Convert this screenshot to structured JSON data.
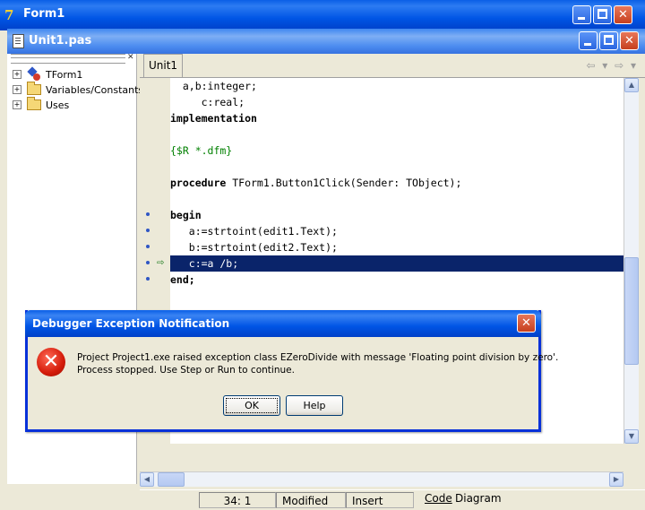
{
  "form_window": {
    "title": "Form1",
    "icon_label": "7"
  },
  "unit_window": {
    "title": "Unit1.pas"
  },
  "tree": {
    "items": [
      {
        "label": "TForm1",
        "icon": "form-class-icon"
      },
      {
        "label": "Variables/Constants",
        "icon": "folder-icon"
      },
      {
        "label": "Uses",
        "icon": "folder-icon"
      }
    ]
  },
  "editor": {
    "tab": "Unit1",
    "lines": [
      "  a,b:integer;",
      "     c:real;",
      "implementation",
      "",
      "{$R *.dfm}",
      "",
      "procedure TForm1.Button1Click(Sender: TObject);",
      "",
      "begin",
      "   a:=strtoint(edit1.Text);",
      "   b:=strtoint(edit2.Text);",
      "   c:=a /b;",
      "end;"
    ]
  },
  "status": {
    "position": "34:  1",
    "modified": "Modified",
    "insert": "Insert",
    "tab_code": "Code",
    "tab_diagram": "Diagram"
  },
  "dialog": {
    "title": "Debugger Exception Notification",
    "message_line1": "Project Project1.exe raised exception class EZeroDivide with message 'Floating point division by zero'.",
    "message_line2": "Process stopped. Use Step or Run to continue.",
    "ok_label": "OK",
    "help_label": "Help"
  },
  "colors": {
    "execution_line": "#0A246A",
    "comment": "#008000",
    "titlebar": "#0055E5"
  }
}
